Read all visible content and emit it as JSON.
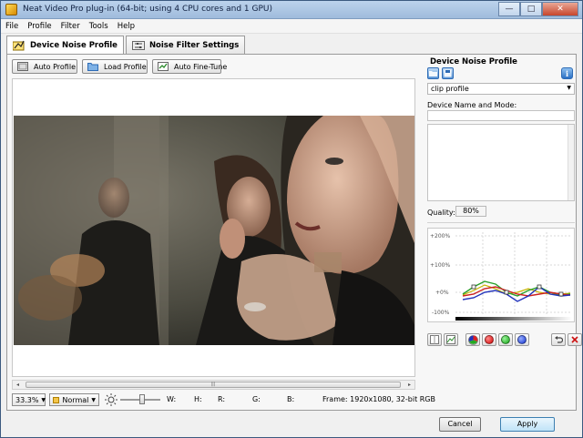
{
  "window": {
    "title": "Neat Video Pro plug-in (64-bit; using 4 CPU cores and 1 GPU)",
    "minimize_glyph": "—",
    "maximize_glyph": "□",
    "close_glyph": "✕"
  },
  "menu": [
    "File",
    "Profile",
    "Filter",
    "Tools",
    "Help"
  ],
  "tabs": [
    {
      "label": "Device Noise Profile",
      "active": true,
      "icon": "noise-profile-icon"
    },
    {
      "label": "Noise Filter Settings",
      "active": false,
      "icon": "filter-settings-icon"
    }
  ],
  "toolbar": {
    "auto_profile": "Auto Profile",
    "load_profile": "Load Profile",
    "auto_fine_tune": "Auto Fine-Tune"
  },
  "scrollbar": {
    "left": "◂",
    "right": "▸",
    "grip": "|||"
  },
  "status": {
    "zoom": "33.3%",
    "mode": "Normal",
    "w_label": "W:",
    "h_label": "H:",
    "r_label": "R:",
    "g_label": "G:",
    "b_label": "B:",
    "frame": "Frame: 1920x1080, 32-bit RGB"
  },
  "right_panel": {
    "heading": "Device Noise Profile",
    "profile_select": "clip profile",
    "device_label": "Device Name and Mode:",
    "device_value": "",
    "quality_label": "Quality:",
    "quality_value": "80%",
    "graph_labels": [
      "+200%",
      "+100%",
      "+0%",
      "-100%"
    ]
  },
  "graph_series_colors": {
    "green": "#2aa02a",
    "red": "#cc2222",
    "blue": "#2233bb",
    "yellow": "#c8b400"
  },
  "graph_dots": [
    "rgb-dot",
    "red-dot",
    "green-dot",
    "blue-dot"
  ],
  "footer": {
    "cancel": "Cancel",
    "apply": "Apply"
  }
}
